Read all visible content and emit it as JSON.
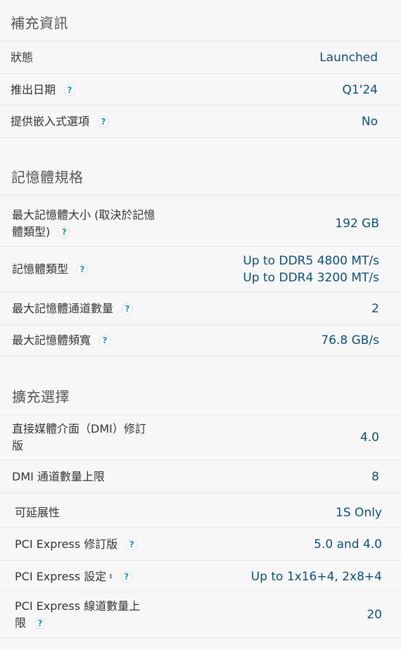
{
  "sections": [
    {
      "title": "補充資訊",
      "rows": [
        {
          "label": "狀態",
          "value": "Launched",
          "help": false
        },
        {
          "label": "推出日期",
          "value": "Q1'24",
          "help": true
        },
        {
          "label": "提供嵌入式選項",
          "value": "No",
          "help": true
        }
      ]
    },
    {
      "title": "記憶體規格",
      "rows": [
        {
          "label_line1": "最大記憶體大小 (取決於記憶",
          "label_line2": "體類型)",
          "value": "192 GB",
          "help": true
        },
        {
          "label": "記憶體類型",
          "value_line1": "Up to DDR5 4800 MT/s",
          "value_line2": "Up to DDR4 3200 MT/s",
          "help": true
        },
        {
          "label": "最大記憶體通道數量",
          "value": "2",
          "help": true
        },
        {
          "label": "最大記憶體頻寬",
          "value": "76.8 GB/s",
          "help": true
        }
      ]
    },
    {
      "title": "擴充選擇",
      "rows": [
        {
          "label_line1": "直接媒體介面（DMI）修訂",
          "label_line2": "版",
          "value": "4.0",
          "help": false
        },
        {
          "label": "DMI 通道數量上限",
          "value": "8",
          "help": false
        },
        {
          "label": "可延展性",
          "value": "1S Only",
          "help": false
        },
        {
          "label": "PCI Express 修訂版",
          "value": "5.0 and 4.0",
          "help": true
        },
        {
          "label": "PCI Express 設定",
          "label_sup": "‡",
          "value": "Up to 1x16+4, 2x8+4",
          "help": true
        },
        {
          "label_line1": "PCI Express 線道數量上",
          "label_line2": "限",
          "value": "20",
          "help": true
        }
      ]
    }
  ],
  "help_icon": {
    "glyph": "?",
    "name": "help-icon",
    "color": "#1e88c9"
  },
  "colors": {
    "value_text": "#0b4f7c",
    "label_text": "#333333",
    "title_text": "#555555",
    "background": "#f7f7f7",
    "divider": "#e6e6e6"
  }
}
